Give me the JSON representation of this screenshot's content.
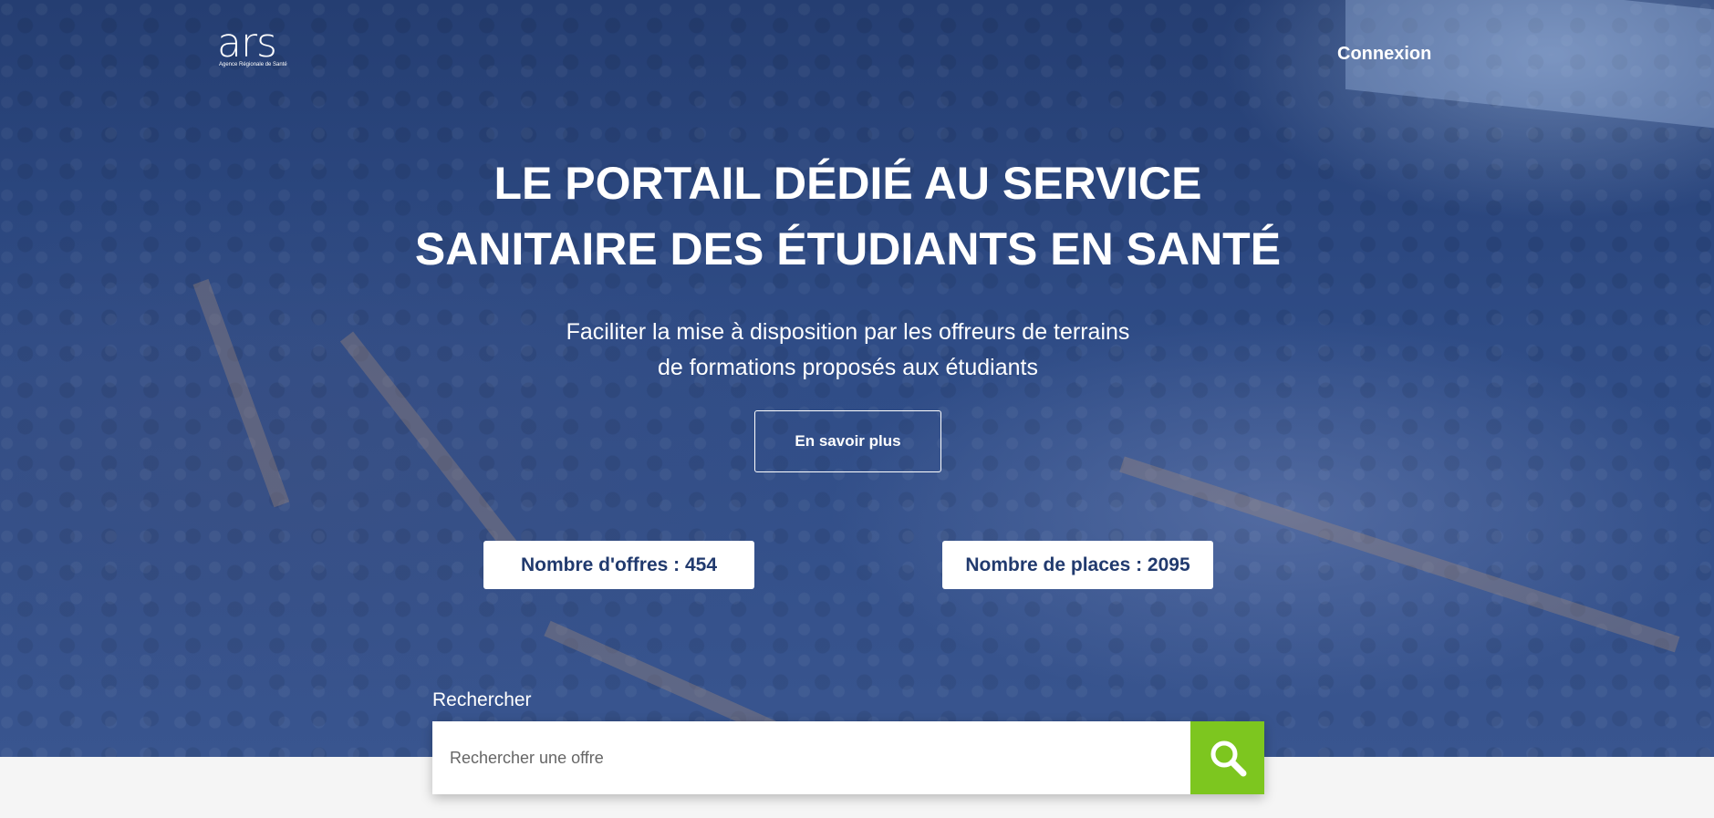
{
  "header": {
    "logo_text": "ars",
    "logo_subtitle": "Agence Régionale de Santé",
    "login_label": "Connexion"
  },
  "hero": {
    "title_line1": "LE PORTAIL DÉDIÉ AU SERVICE",
    "title_line2": "SANITAIRE DES ÉTUDIANTS EN SANTÉ",
    "subtitle_line1": "Faciliter la mise à disposition par les offreurs de terrains",
    "subtitle_line2": "de formations proposés aux étudiants",
    "more_button_label": "En savoir plus"
  },
  "stats": {
    "offers_label": "Nombre d'offres : 454",
    "places_label": "Nombre de places : 2095"
  },
  "search": {
    "label": "Rechercher",
    "placeholder": "Rechercher une offre",
    "value": "",
    "button_icon": "search-icon"
  },
  "colors": {
    "hero_overlay": "#2f4c86",
    "stat_text": "#213a6e",
    "search_button": "#7dc61f",
    "page_background": "#f5f5f5"
  }
}
